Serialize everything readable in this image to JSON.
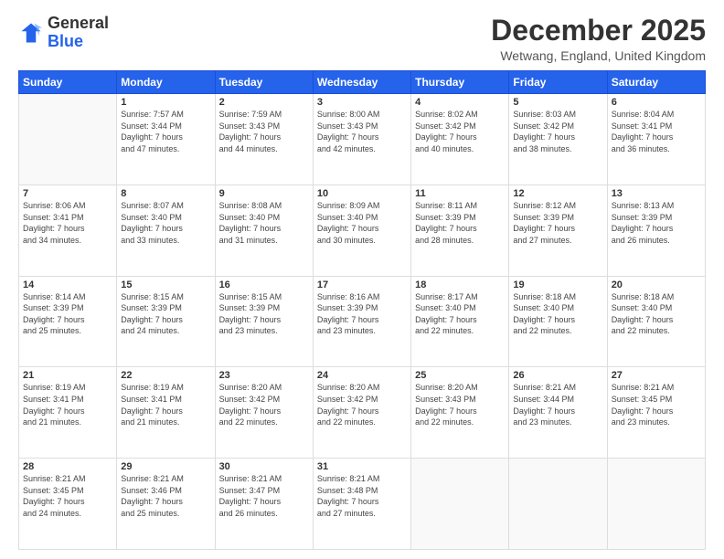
{
  "header": {
    "logo_general": "General",
    "logo_blue": "Blue",
    "month_title": "December 2025",
    "location": "Wetwang, England, United Kingdom"
  },
  "days_of_week": [
    "Sunday",
    "Monday",
    "Tuesday",
    "Wednesday",
    "Thursday",
    "Friday",
    "Saturday"
  ],
  "weeks": [
    [
      {
        "day": "",
        "info": ""
      },
      {
        "day": "1",
        "info": "Sunrise: 7:57 AM\nSunset: 3:44 PM\nDaylight: 7 hours\nand 47 minutes."
      },
      {
        "day": "2",
        "info": "Sunrise: 7:59 AM\nSunset: 3:43 PM\nDaylight: 7 hours\nand 44 minutes."
      },
      {
        "day": "3",
        "info": "Sunrise: 8:00 AM\nSunset: 3:43 PM\nDaylight: 7 hours\nand 42 minutes."
      },
      {
        "day": "4",
        "info": "Sunrise: 8:02 AM\nSunset: 3:42 PM\nDaylight: 7 hours\nand 40 minutes."
      },
      {
        "day": "5",
        "info": "Sunrise: 8:03 AM\nSunset: 3:42 PM\nDaylight: 7 hours\nand 38 minutes."
      },
      {
        "day": "6",
        "info": "Sunrise: 8:04 AM\nSunset: 3:41 PM\nDaylight: 7 hours\nand 36 minutes."
      }
    ],
    [
      {
        "day": "7",
        "info": "Sunrise: 8:06 AM\nSunset: 3:41 PM\nDaylight: 7 hours\nand 34 minutes."
      },
      {
        "day": "8",
        "info": "Sunrise: 8:07 AM\nSunset: 3:40 PM\nDaylight: 7 hours\nand 33 minutes."
      },
      {
        "day": "9",
        "info": "Sunrise: 8:08 AM\nSunset: 3:40 PM\nDaylight: 7 hours\nand 31 minutes."
      },
      {
        "day": "10",
        "info": "Sunrise: 8:09 AM\nSunset: 3:40 PM\nDaylight: 7 hours\nand 30 minutes."
      },
      {
        "day": "11",
        "info": "Sunrise: 8:11 AM\nSunset: 3:39 PM\nDaylight: 7 hours\nand 28 minutes."
      },
      {
        "day": "12",
        "info": "Sunrise: 8:12 AM\nSunset: 3:39 PM\nDaylight: 7 hours\nand 27 minutes."
      },
      {
        "day": "13",
        "info": "Sunrise: 8:13 AM\nSunset: 3:39 PM\nDaylight: 7 hours\nand 26 minutes."
      }
    ],
    [
      {
        "day": "14",
        "info": "Sunrise: 8:14 AM\nSunset: 3:39 PM\nDaylight: 7 hours\nand 25 minutes."
      },
      {
        "day": "15",
        "info": "Sunrise: 8:15 AM\nSunset: 3:39 PM\nDaylight: 7 hours\nand 24 minutes."
      },
      {
        "day": "16",
        "info": "Sunrise: 8:15 AM\nSunset: 3:39 PM\nDaylight: 7 hours\nand 23 minutes."
      },
      {
        "day": "17",
        "info": "Sunrise: 8:16 AM\nSunset: 3:39 PM\nDaylight: 7 hours\nand 23 minutes."
      },
      {
        "day": "18",
        "info": "Sunrise: 8:17 AM\nSunset: 3:40 PM\nDaylight: 7 hours\nand 22 minutes."
      },
      {
        "day": "19",
        "info": "Sunrise: 8:18 AM\nSunset: 3:40 PM\nDaylight: 7 hours\nand 22 minutes."
      },
      {
        "day": "20",
        "info": "Sunrise: 8:18 AM\nSunset: 3:40 PM\nDaylight: 7 hours\nand 22 minutes."
      }
    ],
    [
      {
        "day": "21",
        "info": "Sunrise: 8:19 AM\nSunset: 3:41 PM\nDaylight: 7 hours\nand 21 minutes."
      },
      {
        "day": "22",
        "info": "Sunrise: 8:19 AM\nSunset: 3:41 PM\nDaylight: 7 hours\nand 21 minutes."
      },
      {
        "day": "23",
        "info": "Sunrise: 8:20 AM\nSunset: 3:42 PM\nDaylight: 7 hours\nand 22 minutes."
      },
      {
        "day": "24",
        "info": "Sunrise: 8:20 AM\nSunset: 3:42 PM\nDaylight: 7 hours\nand 22 minutes."
      },
      {
        "day": "25",
        "info": "Sunrise: 8:20 AM\nSunset: 3:43 PM\nDaylight: 7 hours\nand 22 minutes."
      },
      {
        "day": "26",
        "info": "Sunrise: 8:21 AM\nSunset: 3:44 PM\nDaylight: 7 hours\nand 23 minutes."
      },
      {
        "day": "27",
        "info": "Sunrise: 8:21 AM\nSunset: 3:45 PM\nDaylight: 7 hours\nand 23 minutes."
      }
    ],
    [
      {
        "day": "28",
        "info": "Sunrise: 8:21 AM\nSunset: 3:45 PM\nDaylight: 7 hours\nand 24 minutes."
      },
      {
        "day": "29",
        "info": "Sunrise: 8:21 AM\nSunset: 3:46 PM\nDaylight: 7 hours\nand 25 minutes."
      },
      {
        "day": "30",
        "info": "Sunrise: 8:21 AM\nSunset: 3:47 PM\nDaylight: 7 hours\nand 26 minutes."
      },
      {
        "day": "31",
        "info": "Sunrise: 8:21 AM\nSunset: 3:48 PM\nDaylight: 7 hours\nand 27 minutes."
      },
      {
        "day": "",
        "info": ""
      },
      {
        "day": "",
        "info": ""
      },
      {
        "day": "",
        "info": ""
      }
    ]
  ]
}
